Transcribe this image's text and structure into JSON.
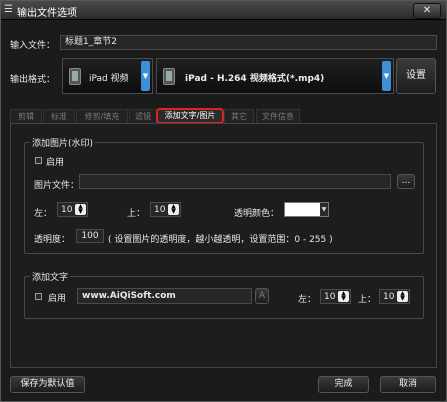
{
  "window": {
    "title": "输出文件选项",
    "close_symbol": "✕"
  },
  "input_file": {
    "label": "输入文件：",
    "value": "标题1_章节2"
  },
  "output_format": {
    "label": "输出格式：",
    "device": "iPad 视频",
    "format": "iPad - H.264 视频格式(*.mp4)",
    "settings_button": "设置"
  },
  "tabs": [
    {
      "label": "剪辑",
      "active": false
    },
    {
      "label": "标准",
      "active": false
    },
    {
      "label": "修剪/填充",
      "active": false
    },
    {
      "label": "滤镜",
      "active": false
    },
    {
      "label": "添加文字/图片",
      "active": true
    },
    {
      "label": "其它",
      "active": false
    },
    {
      "label": "文件信息",
      "active": false
    }
  ],
  "watermark": {
    "group_title": "添加图片(水印)",
    "enable_label": "启用",
    "image_file_label": "图片文件：",
    "image_file_value": "",
    "browse_label": "...",
    "left_label": "左：",
    "left_value": "10",
    "top_label": "上：",
    "top_value": "10",
    "transparent_color_label": "透明颜色：",
    "transparent_color": "#ffffff",
    "opacity_label": "透明度：",
    "opacity_value": "100",
    "opacity_hint": "( 设置图片的透明度，越小越透明，设置范围：0 - 255 )"
  },
  "text": {
    "group_title": "添加文字",
    "enable_label": "启用",
    "text_value": "www.AiQiSoft.com",
    "font_button": "A",
    "left_label": "左：",
    "left_value": "10",
    "top_label": "上：",
    "top_value": "10"
  },
  "footer": {
    "save_default": "保存为默认值",
    "done": "完成",
    "cancel": "取消"
  },
  "colors": {
    "accent": "#3f8fd6",
    "active_tab_border": "#dd2222"
  }
}
